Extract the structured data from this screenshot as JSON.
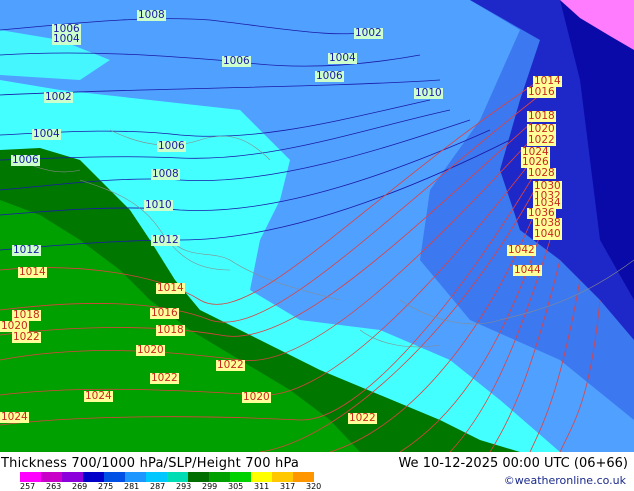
{
  "title": "Thickness 700/1000 hPa/SLP/Height 700 hPa",
  "datetime": "We 10-12-2025 00:00 UTC (06+66)",
  "credit": "©weatheronline.co.uk",
  "colors": {
    "ocean_blue": "#1e28c8",
    "blue_mid": "#3c78f0",
    "blue_light": "#50a0ff",
    "cyan": "#44ffff",
    "green_dark": "#007800",
    "green_mid": "#00a000",
    "magenta": "#ff7cff",
    "isobar_blue": "#1a1aa8",
    "isobar_red": "#e04040"
  },
  "legend": {
    "ticks": [
      "257",
      "263",
      "269",
      "275",
      "281",
      "287",
      "293",
      "299",
      "305",
      "311",
      "317",
      "320"
    ],
    "colors": [
      "#ff00ff",
      "#c800c8",
      "#8c00dc",
      "#0000c8",
      "#0050e6",
      "#1e96ff",
      "#00c8ff",
      "#00dcb4",
      "#006e00",
      "#00a000",
      "#00d200",
      "#ffff00",
      "#ffc800",
      "#ff9600"
    ]
  },
  "isobars": {
    "blue": [
      "1008",
      "1006",
      "1004",
      "1002",
      "1004",
      "1006",
      "1006",
      "1010",
      "1002",
      "1004",
      "1006",
      "1006",
      "1008",
      "1010",
      "1012",
      "1012"
    ],
    "red": [
      "1014",
      "1016",
      "1018",
      "1020",
      "1022",
      "1024",
      "1026",
      "1028",
      "1030",
      "1032",
      "1034",
      "1036",
      "1038",
      "1040",
      "1042",
      "1044",
      "1014",
      "1014",
      "1016",
      "1018",
      "1018",
      "1020",
      "1022",
      "1020",
      "1022",
      "1022",
      "1024",
      "1024",
      "1020",
      "1022"
    ]
  }
}
